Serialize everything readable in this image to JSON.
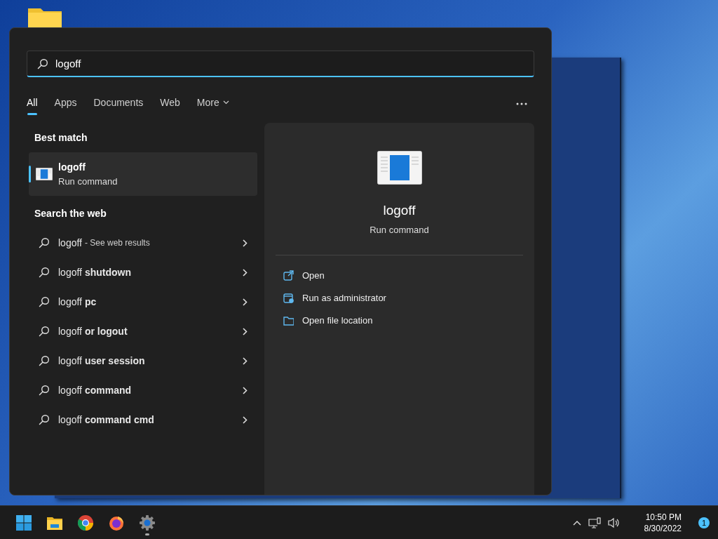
{
  "search": {
    "value": "logoff"
  },
  "tabs": [
    {
      "label": "All",
      "kind": "tab",
      "selected": true
    },
    {
      "label": "Apps",
      "kind": "tab",
      "selected": false
    },
    {
      "label": "Documents",
      "kind": "tab",
      "selected": false
    },
    {
      "label": "Web",
      "kind": "tab",
      "selected": false
    },
    {
      "label": "More",
      "kind": "dropdown",
      "selected": false
    }
  ],
  "best_match": {
    "heading": "Best match",
    "item": {
      "title": "logoff",
      "subtitle": "Run command",
      "selected": true
    }
  },
  "web": {
    "heading": "Search the web",
    "items": [
      {
        "text": "logoff",
        "hint": "- See web results"
      },
      {
        "text": "logoff **shutdown**"
      },
      {
        "text": "logoff **pc**"
      },
      {
        "text": "logoff **or logout**"
      },
      {
        "text": "logoff **user session**"
      },
      {
        "text": "logoff **command**"
      },
      {
        "text": "logoff **command cmd**"
      }
    ]
  },
  "preview": {
    "title": "logoff",
    "subtitle": "Run command",
    "actions": [
      {
        "label": "Open",
        "kind": "open"
      },
      {
        "label": "Run as administrator",
        "kind": "admin"
      },
      {
        "label": "Open file location",
        "kind": "folder"
      }
    ]
  },
  "taskbar": {
    "apps": [
      {
        "kind": "start",
        "running": false
      },
      {
        "kind": "explorer",
        "running": false
      },
      {
        "kind": "chrome",
        "running": false
      },
      {
        "kind": "firefox",
        "running": false
      },
      {
        "kind": "settings",
        "running": true
      }
    ],
    "time": "10:50 PM",
    "date": "8/30/2022",
    "notifications": "1"
  }
}
